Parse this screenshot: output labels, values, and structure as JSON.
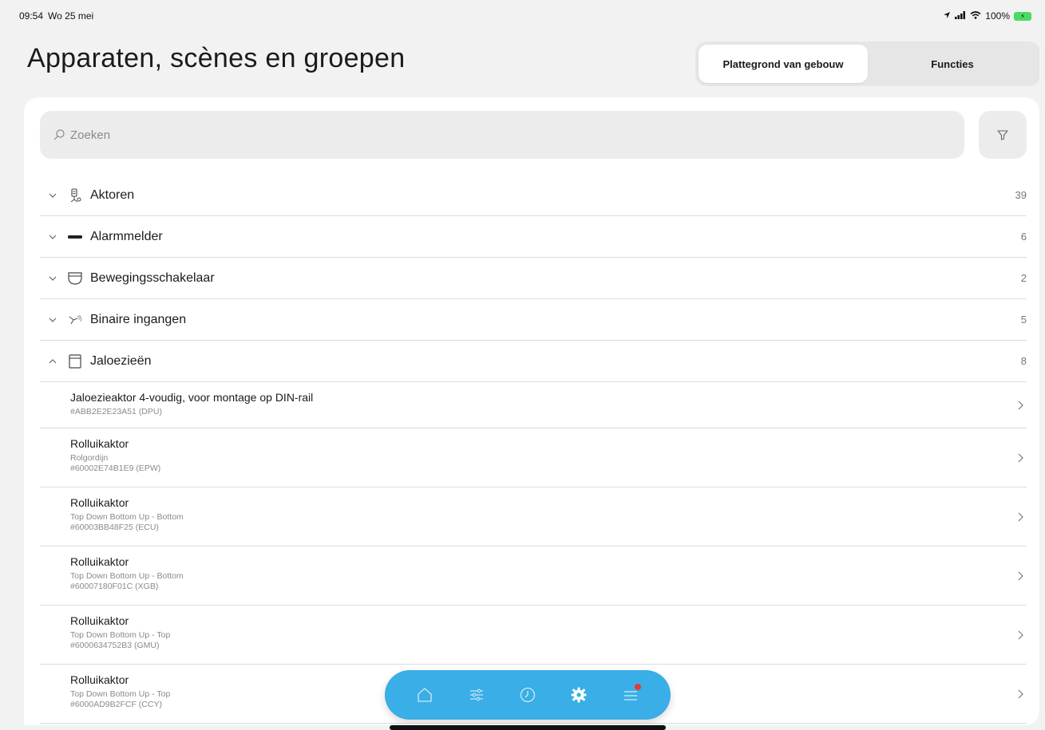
{
  "statusbar": {
    "time": "09:54",
    "date": "Wo 25 mei",
    "battery": "100%"
  },
  "header": {
    "title": "Apparaten, scènes en groepen"
  },
  "segments": [
    {
      "label": "Plattegrond van gebouw",
      "active": true
    },
    {
      "label": "Functies",
      "active": false
    }
  ],
  "search": {
    "placeholder": "Zoeken"
  },
  "groups": [
    {
      "label": "Aktoren",
      "count": "39",
      "icon": "actuator-icon",
      "expanded": false
    },
    {
      "label": "Alarmmelder",
      "count": "6",
      "icon": "alarm-icon",
      "expanded": false
    },
    {
      "label": "Bewegingsschakelaar",
      "count": "2",
      "icon": "motion-icon",
      "expanded": false
    },
    {
      "label": "Binaire ingangen",
      "count": "5",
      "icon": "binary-input-icon",
      "expanded": false
    },
    {
      "label": "Jaloezieën",
      "count": "8",
      "icon": "blind-icon",
      "expanded": true
    }
  ],
  "items": [
    {
      "title": "Jaloezieaktor 4-voudig, voor montage op DIN-rail",
      "lines": [
        "#ABB2E2E23A51 (DPU)"
      ]
    },
    {
      "title": "Rolluikaktor",
      "lines": [
        "Rolgordijn",
        "#60002E74B1E9 (EPW)"
      ]
    },
    {
      "title": "Rolluikaktor",
      "lines": [
        "Top Down Bottom Up - Bottom",
        "#60003BB48F25 (ECU)"
      ]
    },
    {
      "title": "Rolluikaktor",
      "lines": [
        "Top Down Bottom Up - Bottom",
        "#60007180F01C (XGB)"
      ]
    },
    {
      "title": "Rolluikaktor",
      "lines": [
        "Top Down Bottom Up - Top",
        "#6000634752B3 (GMU)"
      ]
    },
    {
      "title": "Rolluikaktor",
      "lines": [
        "Top Down Bottom Up - Top",
        "#6000AD9B2FCF (CCY)"
      ]
    }
  ],
  "tabbar": {
    "accent": "#3aaee6",
    "tabs": [
      "home-icon",
      "sliders-icon",
      "clock-icon",
      "gear-icon",
      "menu-icon"
    ],
    "active": "gear-icon",
    "badge_on": "menu-icon"
  }
}
